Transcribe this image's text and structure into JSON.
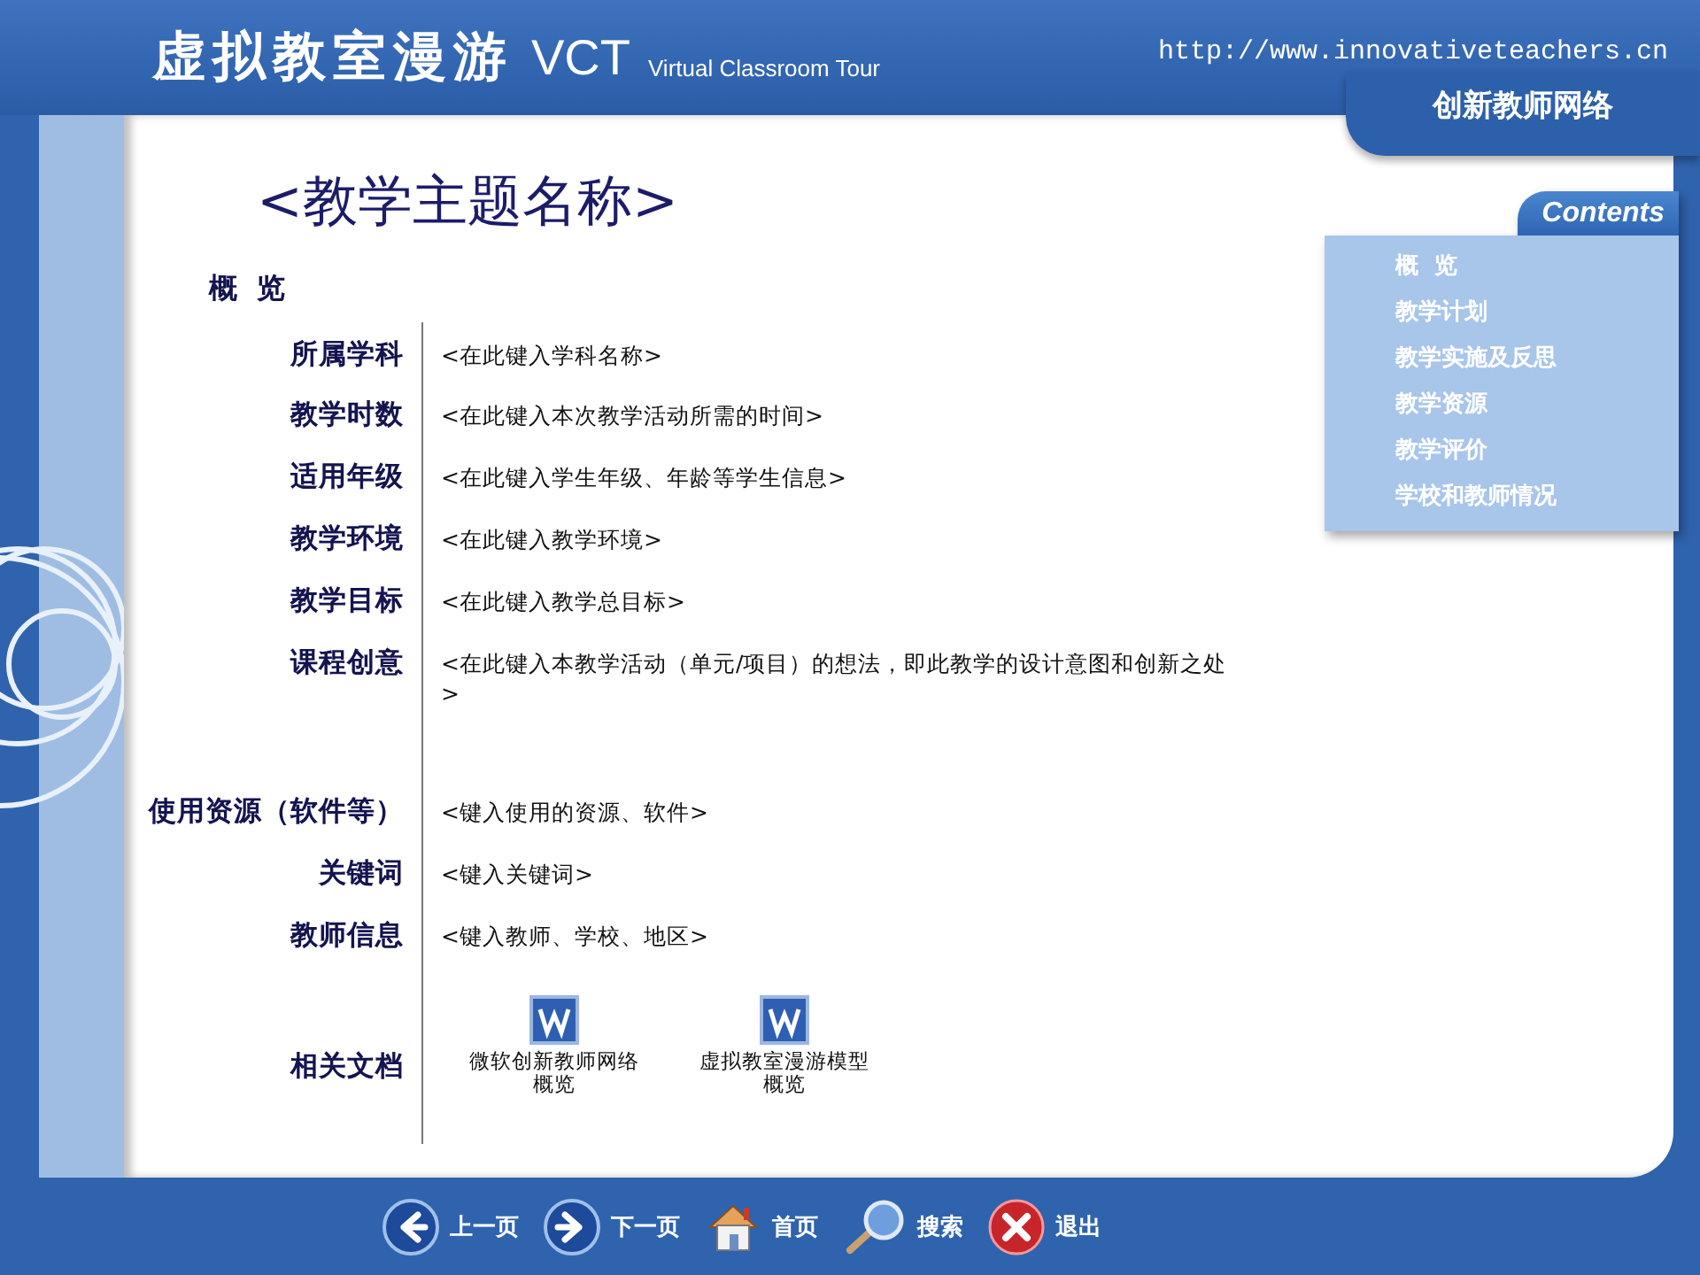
{
  "header": {
    "title": "虚拟教室漫游",
    "abbr": "VCT",
    "subtitle": "Virtual Classroom Tour",
    "url": "http://www.innovativeteachers.cn",
    "network": "创新教师网络"
  },
  "page_title": "<教学主题名称>",
  "section": "概  览",
  "fields": [
    {
      "kind": "field",
      "label": "所属学科",
      "value": "<在此键入学科名称>"
    },
    {
      "kind": "field",
      "label": "教学时数",
      "value": "<在此键入本次教学活动所需的时间>"
    },
    {
      "kind": "field",
      "label": "适用年级",
      "value": "<在此键入学生年级、年龄等学生信息>"
    },
    {
      "kind": "field",
      "label": "教学环境",
      "value": "<在此键入教学环境>"
    },
    {
      "kind": "field",
      "label": "教学目标",
      "value": "<在此键入教学总目标>"
    },
    {
      "kind": "field",
      "label": "课程创意",
      "value": "<在此键入本教学活动（单元/项目）的想法，即此教学的设计意图和创新之处>"
    },
    {
      "kind": "gap"
    },
    {
      "kind": "field",
      "label": "使用资源（软件等）",
      "value": "<键入使用的资源、软件>"
    },
    {
      "kind": "field",
      "label": "关键词",
      "value": "<键入关键词>"
    },
    {
      "kind": "field",
      "label": "教师信息",
      "value": "<键入教师、学校、地区>"
    },
    {
      "kind": "documents",
      "label": "相关文档",
      "items": [
        {
          "name": "微软创新教师网络概览"
        },
        {
          "name": "虚拟教室漫游模型概览"
        }
      ]
    }
  ],
  "contents": {
    "title": "Contents",
    "items": [
      "概  览",
      "教学计划",
      "教学实施及反思",
      "教学资源",
      "教学评价",
      "学校和教师情况"
    ]
  },
  "nav": [
    {
      "kind": "prev",
      "label": "上一页"
    },
    {
      "kind": "next",
      "label": "下一页"
    },
    {
      "kind": "home",
      "label": "首页"
    },
    {
      "kind": "search",
      "label": "搜索"
    },
    {
      "kind": "exit",
      "label": "退出"
    }
  ]
}
